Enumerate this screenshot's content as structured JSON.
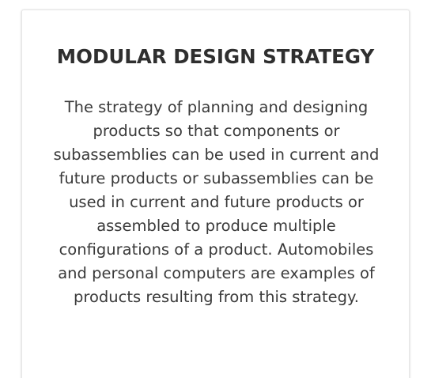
{
  "card": {
    "title": "MODULAR DESIGN STRATEGY",
    "body": "The strategy of planning and designing products so that components or subassemblies can be used in current and future products or subassemblies can be used in current and future products or assembled to produce multiple configurations of a product. Automobiles and personal computers are examples of products resulting from this strategy."
  }
}
